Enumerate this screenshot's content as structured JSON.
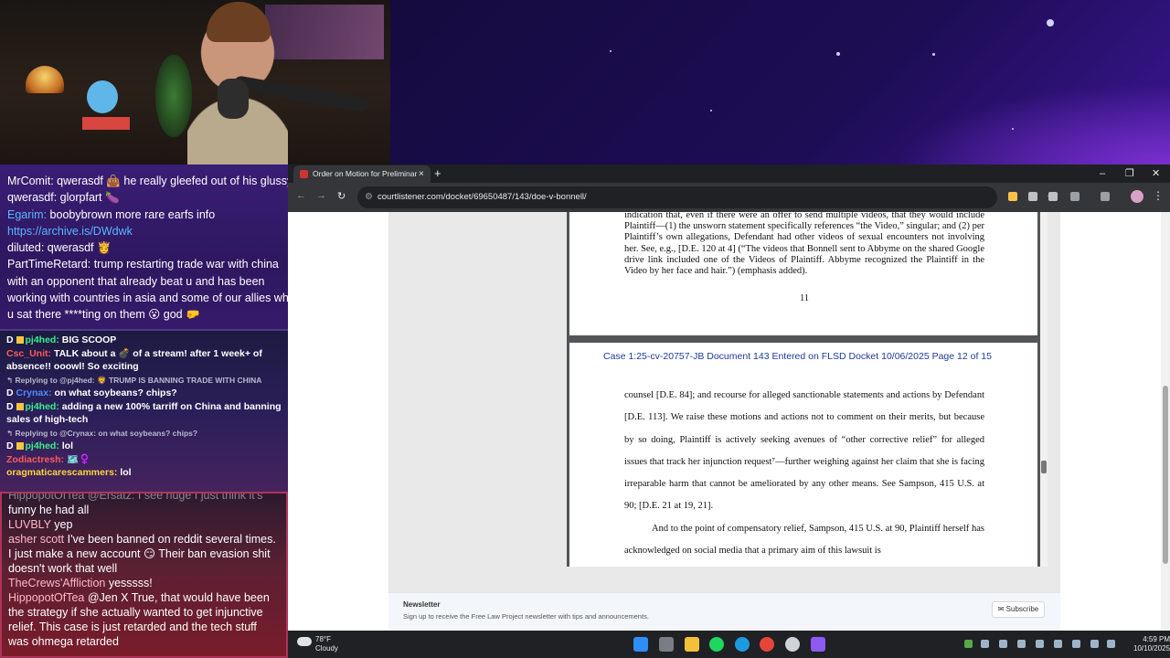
{
  "chat_top": {
    "messages": [
      {
        "user": "MrComit:",
        "text": " qwerasdf 👜 he really gleefed out of his glussy"
      },
      {
        "user": "qwerasdf:",
        "text": " glorpfart 🍆"
      },
      {
        "user": "Egarim:",
        "text": " boobybrown more rare earfs info"
      },
      {
        "user": "",
        "text": "https://archive.is/DWdwk",
        "link": true
      },
      {
        "user": "diluted:",
        "text": " qwerasdf 👸"
      },
      {
        "user": "PartTimeRetard:",
        "text": " trump restarting trade war with china"
      },
      {
        "user": "",
        "text": "with an opponent that already beat u and has been"
      },
      {
        "user": "",
        "text": "working with countries in asia and some of our allies while"
      },
      {
        "user": "",
        "text": "u sat there ****ting on them 😮 god 🤛"
      }
    ]
  },
  "chat_mid": {
    "messages": [
      {
        "user": "pj4hed:",
        "text": "BIG SCOOP",
        "color": "g"
      },
      {
        "user": "Csc_Unit:",
        "text": "TALK about a 💣 of a stream! after 1 week+ of absence!! ooowl! So exciting",
        "color": "r"
      },
      {
        "reply": "↰ Replying to @pj4hed: 🦁 TRUMP IS BANNING TRADE WITH CHINA"
      },
      {
        "user": "Crynax:",
        "text": "on what soybeans? chips?",
        "color": "b"
      },
      {
        "user": "pj4hed:",
        "text": "adding a new 100% tarriff on China and banning sales of high-tech",
        "color": "g"
      },
      {
        "reply": "↰ Replying to @Crynax: on what soybeans? chips?"
      },
      {
        "user": "pj4hed:",
        "text": "lol",
        "color": "g"
      },
      {
        "user": "Zodiactresh:",
        "text": "🗺️♀️",
        "color": "r"
      },
      {
        "user": "oragmaticarescammers:",
        "text": "lol",
        "color": "y"
      }
    ]
  },
  "chat_bot": {
    "faded_line": "HippopotOfTea @Ersatz: I see huge I just think it's",
    "messages": [
      {
        "user": "",
        "text": "funny he had all"
      },
      {
        "user": "LUVBLY",
        "text": " yep"
      },
      {
        "user": "asher scott",
        "text": " I've been banned on reddit several times. I just make a new account 😏 Their ban evasion shit doesn't work that well"
      },
      {
        "user": "TheCrews'Affliction",
        "text": " yesssss!"
      },
      {
        "user": "HippopotOfTea",
        "text": " @Jen X True, that would have been the strategy if she actually wanted to get injunctive relief. This case is just retarded and the tech stuff was ohmega retarded"
      }
    ]
  },
  "browser": {
    "tab_title": "Order on Motion for Preliminar",
    "url": "courtlistener.com/docket/69650487/143/doe-v-bonnell/",
    "controls": {
      "new_tab": "+",
      "minimize": "–",
      "maximize": "❐",
      "close": "✕",
      "tab_close": "×"
    }
  },
  "pdf": {
    "page11_text": "indication that, even if there were an offer to send multiple videos, that they would include Plaintiff—(1) the unsworn statement specifically references “the Video,” singular; and (2) per Plaintiff’s own allegations, Defendant had other videos of sexual encounters not involving her. See, e.g., [D.E. 120 at 4] (“The videos that Bonnell sent to Abbyme on the shared Google drive link included one of the Videos of Plaintiff. Abbyme recognized the Plaintiff in the Video by her face and hair.”) (emphasis added).",
    "page11_number": "11",
    "page12_header": "Case 1:25-cv-20757-JB   Document 143   Entered on FLSD Docket 10/06/2025   Page 12 of 15",
    "page12_para1": "counsel [D.E. 84]; and recourse for alleged sanctionable statements and actions by Defendant [D.E. 113]. We raise these motions and actions not to comment on their merits, but because by so doing, Plaintiff is actively seeking avenues of “other corrective relief” for alleged issues that track her injunction request⁷—further weighing against her claim that she is facing irreparable harm that cannot be ameliorated by any other means. See Sampson, 415 U.S. at 90; [D.E. 21 at 19, 21].",
    "page12_para2": "And to the point of compensatory relief, Sampson, 415 U.S. at 90, Plaintiff herself has acknowledged on social media that a primary aim of this lawsuit is"
  },
  "newsletter": {
    "title": "Newsletter",
    "subtitle": "Sign up to receive the Free Law Project newsletter with tips and announcements.",
    "button": "Subscribe"
  },
  "taskbar": {
    "temp": "78°F",
    "condition": "Cloudy",
    "time": "4:59 PM",
    "date": "10/10/2025"
  },
  "colors": {
    "accent_link": "#1d3b9a",
    "chat_green": "#38f08a",
    "chat_red": "#ff5a5a",
    "chat_blue": "#4c8cff"
  }
}
